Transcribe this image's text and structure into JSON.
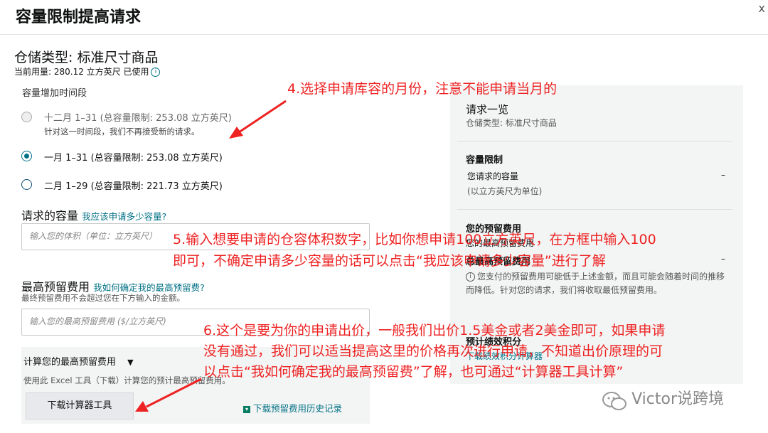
{
  "dialog": {
    "title": "容量限制提高请求",
    "close_label": "x"
  },
  "storage": {
    "type_label": "仓储类型: 标准尺寸商品",
    "usage_label": "当前用量: 280.12 立方英尺 已使用"
  },
  "period": {
    "label": "容量增加时间段",
    "options": [
      {
        "text": "十二月 1–31 (总容量限制: 253.08 立方英尺)",
        "sub": "针对这一时间段，我们不再接受新的请求。",
        "state": "disabled"
      },
      {
        "text": "一月 1–31 (总容量限制: 253.08 立方英尺)",
        "sub": "",
        "state": "selected"
      },
      {
        "text": "二月 1–29 (总容量限制: 221.73 立方英尺)",
        "sub": "",
        "state": "unselected"
      }
    ]
  },
  "capacity": {
    "heading": "请求的容量",
    "help_link": "我应该申请多少容量?",
    "placeholder": "输入您的体积（单位：立方英尺）"
  },
  "max_fee": {
    "heading": "最高预留费用",
    "help_link": "我如何确定我的最高预留费?",
    "hint": "最终预留费用不会超过您在下方输入的金额。",
    "placeholder": "输入您的最高预留费用 ($/立方英尺)"
  },
  "calculator": {
    "heading": "计算您的最高预留费用",
    "toggle_icon": "▼",
    "desc": "使用此 Excel 工具（下载）计算您的预计最高预留费用。",
    "download_button": "下载计算器工具",
    "history_link": "下载预留费用历史记录"
  },
  "summary": {
    "title": "请求一览",
    "subtitle": "仓储类型: 标准尺寸商品",
    "capacity_heading": "容量限制",
    "capacity_row": "您请求的容量",
    "capacity_unit": "(以立方英尺为单位)",
    "capacity_value": "–",
    "fee_heading": "您的预留费用",
    "fee_row_partial": "您的最高预留费用",
    "total_row": "总最高预留费用",
    "total_value": "–",
    "note": "您支付的预留费用可能低于上述金额，而且可能会随着时间的推移而降低。针对您的请求，我们将收取最低预留费用。",
    "perf_heading": "预计绩效积分",
    "perf_sub": "下载绩效积分计算器"
  },
  "annotations": {
    "a4": "4.选择申请库容的月份，注意不能申请当月的",
    "a5": [
      "5.输入想要申请的仓容体积数字，比如你想申请100立方英尺，在方框中输入100",
      "即可，不确定申请多少容量的话可以点击“我应该申请多少容量”进行了解"
    ],
    "a6": [
      "6.这个是要为你的申请出价，一般我们出价1.5美金或者2美金即可，如果申请",
      "没有通过，我们可以适当提高这里的价格再次进行申请，不知道出价原理的可",
      "以点击“我如何确定我的最高预留费”了解，也可通过“计算器工具计算”"
    ]
  },
  "watermark": "Victor说跨境",
  "colors": {
    "link": "#007185",
    "annotation": "#ee2222"
  }
}
